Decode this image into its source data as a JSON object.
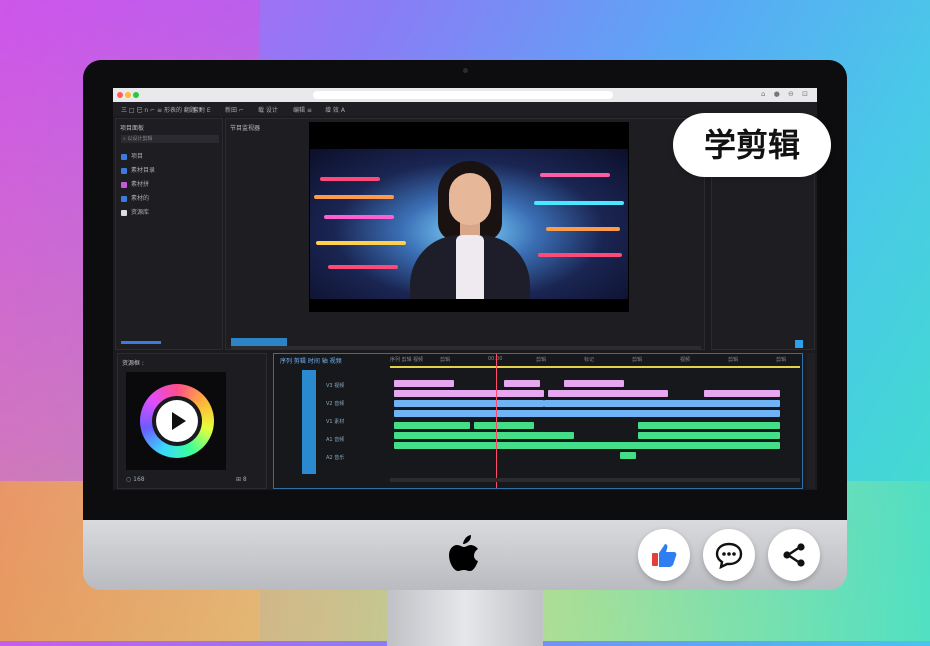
{
  "overlay": {
    "caption": "学剪辑"
  },
  "titlebar": {
    "icons": "⌂ ● ⊖ ⊡"
  },
  "menubar": {
    "items": [
      "三 □ 已 n ⌐ ≡ 形表的 翻题 ↑",
      "套附 E",
      "新田 ⌐",
      "载 设计",
      "编辑 ≡",
      "增 效 A"
    ]
  },
  "project_panel": {
    "title": "项目面板",
    "search": "⌕ 以设计剪辑",
    "items": [
      {
        "label": "项目",
        "icon_color": "#3a7be0"
      },
      {
        "label": "素材目录",
        "icon_color": "#3a7be0"
      },
      {
        "label": "素材拼",
        "icon_color": "#c45adf"
      },
      {
        "label": "素材的",
        "icon_color": "#3a7be0"
      },
      {
        "label": "资源库",
        "icon_color": "#ddd"
      }
    ]
  },
  "program_panel": {
    "title": "节目监视器"
  },
  "media_panel": {
    "title": "资源框 :",
    "footer_left": "○ 168",
    "footer_right": "⊞ 8"
  },
  "timeline": {
    "header": "序列 剪辑 时间 轴 视频",
    "ruler": [
      "序列 剪辑 视频",
      "剪辑",
      "00:00",
      "剪辑",
      "标记",
      "剪辑",
      "视频",
      "剪辑",
      "剪辑"
    ],
    "tracks": [
      "V3 视频",
      "V2 音频",
      "V1 素材",
      "A1 音频",
      "A2 音乐"
    ]
  },
  "colors": {
    "accent": "#2f9df0",
    "clip_pink": "#e7a7f0",
    "clip_blue": "#6fb2f5",
    "clip_green": "#44dd88",
    "playhead": "#ff4a6a"
  },
  "social": {
    "icons": [
      "thumbs-up-icon",
      "comment-icon",
      "share-icon"
    ]
  }
}
